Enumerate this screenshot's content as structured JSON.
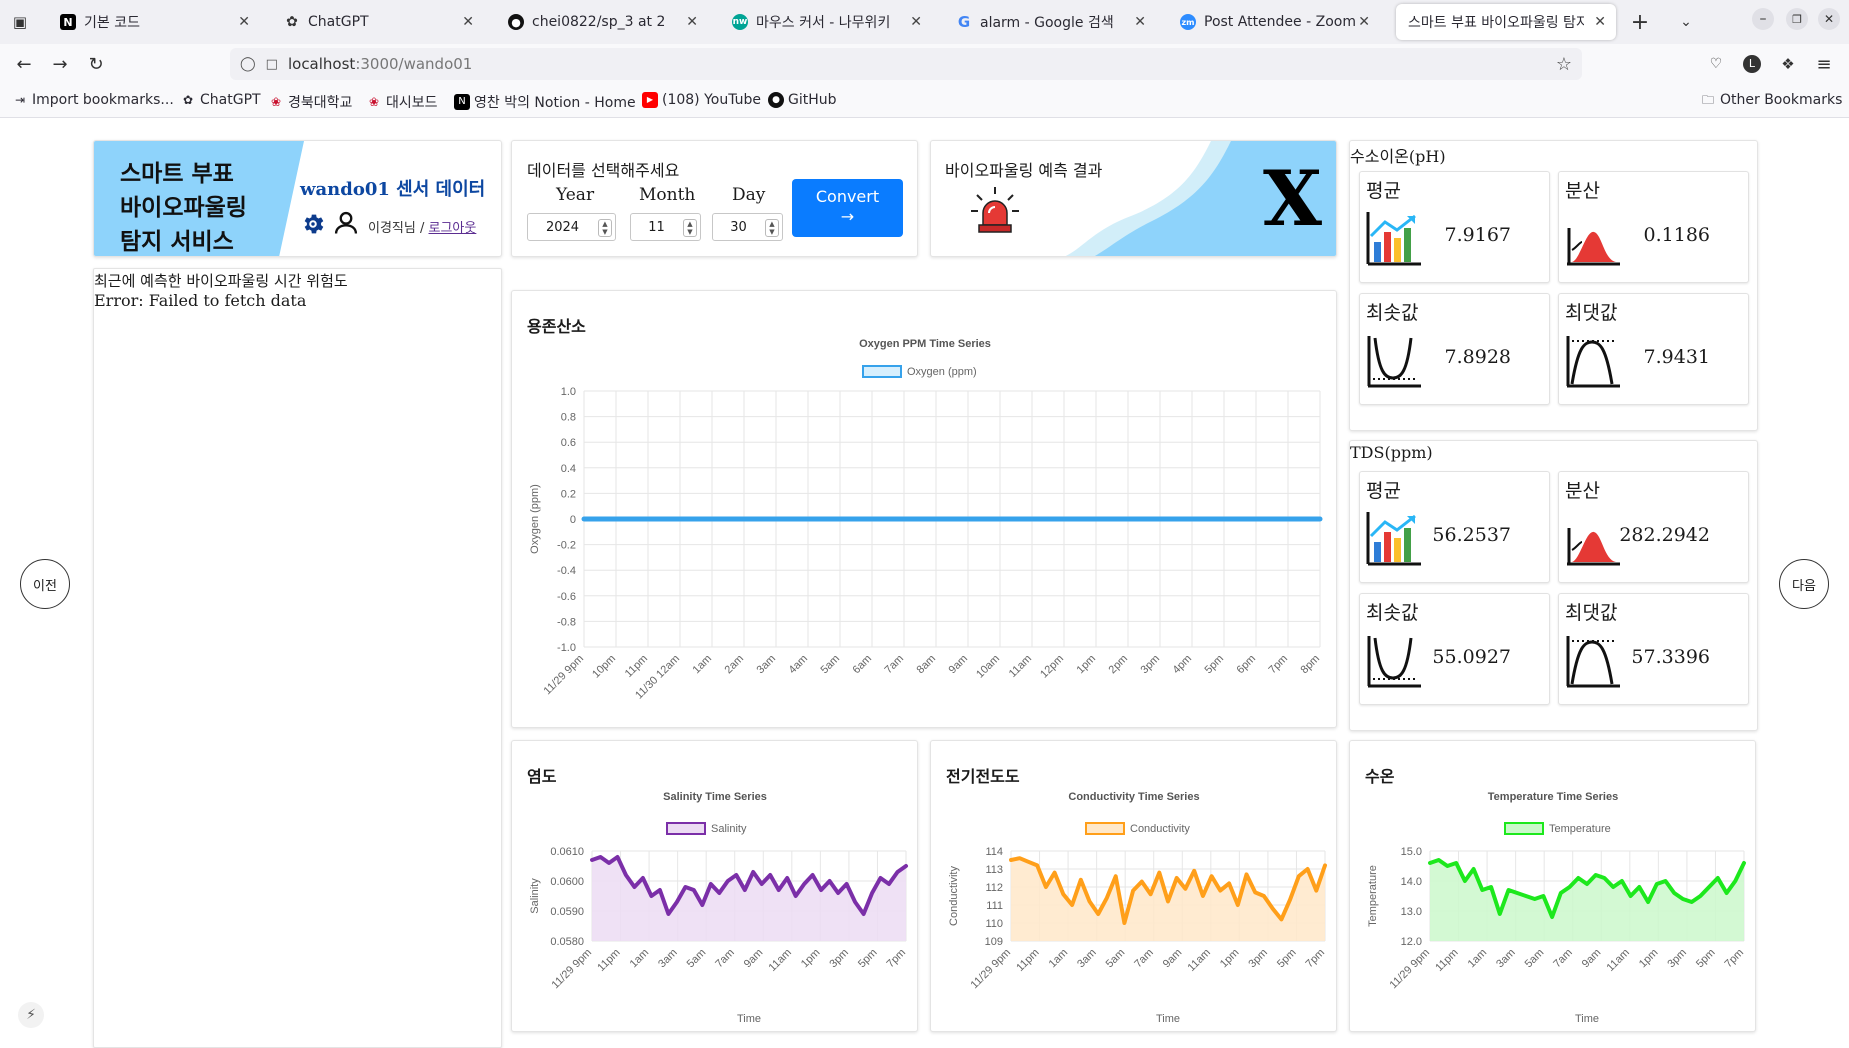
{
  "tabs": [
    {
      "label": "기본 코드",
      "icon": "notion-icon"
    },
    {
      "label": "ChatGPT",
      "icon": "chatgpt-icon"
    },
    {
      "label": "chei0822/sp_3 at 2",
      "icon": "github-icon"
    },
    {
      "label": "마우스 커서 - 나무위키",
      "icon": "namuwiki-icon"
    },
    {
      "label": "alarm - Google 검색",
      "icon": "google-icon"
    },
    {
      "label": "Post Attendee - Zoom",
      "icon": "zoom-icon"
    },
    {
      "label": "스마트 부표 바이오파울링 탐지",
      "icon": ""
    }
  ],
  "url": {
    "host": "localhost",
    "path": ":3000/wando01"
  },
  "bookmarks": [
    {
      "label": "Import bookmarks...",
      "icon": "import-icon"
    },
    {
      "label": "ChatGPT",
      "icon": "chatgpt-icon"
    },
    {
      "label": "경북대학교",
      "icon": "knu-icon"
    },
    {
      "label": "대시보드",
      "icon": "knu-icon"
    },
    {
      "label": "영찬 박의 Notion - Home",
      "icon": "notion-icon"
    },
    {
      "label": "(108) YouTube",
      "icon": "youtube-icon"
    },
    {
      "label": "GitHub",
      "icon": "github-icon"
    }
  ],
  "other_bookmarks": "Other Bookmarks",
  "header": {
    "service_line1": "스마트 부표",
    "service_line2": "바이오파울링",
    "service_line3": "탐지 서비스",
    "sensor_title": "wando01 센서 데이터",
    "user_name": "이경직님",
    "separator": " / ",
    "logout": "로그아웃"
  },
  "select": {
    "title": "데이터를 선택해주세요",
    "year_label": "Year",
    "year": "2024",
    "month_label": "Month",
    "month": "11",
    "day_label": "Day",
    "day": "30",
    "convert_label": "Convert",
    "convert_arrow": "→"
  },
  "prediction": {
    "title": "바이오파울링 예측 결과",
    "result": "X"
  },
  "recent": {
    "title": "최근에 예측한 바이오파울링 시간 위험도",
    "error": "Error: Failed to fetch data"
  },
  "nav": {
    "prev": "이전",
    "next": "다음"
  },
  "ph": {
    "title": "수소이온(pH)",
    "mean_label": "평균",
    "mean": "7.9167",
    "var_label": "분산",
    "var": "0.1186",
    "min_label": "최솟값",
    "min": "7.8928",
    "max_label": "최댓값",
    "max": "7.9431"
  },
  "tds": {
    "title": "TDS(ppm)",
    "mean_label": "평균",
    "mean": "56.2537",
    "var_label": "분산",
    "var": "282.2942",
    "min_label": "최솟값",
    "min": "55.0927",
    "max_label": "최댓값",
    "max": "57.3396"
  },
  "cards": {
    "oxygen": "용존산소",
    "salinity": "염도",
    "conductivity": "전기전도도",
    "temperature": "수온"
  },
  "chart_data": [
    {
      "type": "line",
      "title": "Oxygen PPM Time Series",
      "series_name": "Oxygen (ppm)",
      "ylabel": "Oxygen (ppm)",
      "xlabel": "",
      "color": "#36a2eb",
      "ylim": [
        -1.0,
        1.0
      ],
      "yticks": [
        "1.0",
        "0.8",
        "0.6",
        "0.4",
        "0.2",
        "0",
        "-0.2",
        "-0.4",
        "-0.6",
        "-0.8",
        "-1.0"
      ],
      "xticks": [
        "11/29 9pm",
        "10pm",
        "11pm",
        "11/30 12am",
        "1am",
        "2am",
        "3am",
        "4am",
        "5am",
        "6am",
        "7am",
        "8am",
        "9am",
        "10am",
        "11am",
        "12pm",
        "1pm",
        "2pm",
        "3pm",
        "4pm",
        "5pm",
        "6pm",
        "7pm",
        "8pm"
      ],
      "x": [
        "11/29 9pm",
        "8pm"
      ],
      "values": [
        0,
        0
      ]
    },
    {
      "type": "area",
      "title": "Salinity Time Series",
      "series_name": "Salinity",
      "ylabel": "Salinity",
      "xlabel": "Time",
      "color": "#7b2fa8",
      "fill": "#ecdcf3",
      "ylim": [
        0.058,
        0.061
      ],
      "yticks": [
        "0.0610",
        "0.0600",
        "0.0590",
        "0.0580"
      ],
      "xticks": [
        "11/29 9pm",
        "11pm",
        "1am",
        "3am",
        "5am",
        "7am",
        "9am",
        "11am",
        "1pm",
        "3pm",
        "5pm",
        "7pm"
      ],
      "values": [
        0.0607,
        0.0608,
        0.0606,
        0.0608,
        0.0602,
        0.0598,
        0.0601,
        0.0595,
        0.0597,
        0.0589,
        0.0593,
        0.0598,
        0.0597,
        0.0592,
        0.0599,
        0.0596,
        0.06,
        0.0602,
        0.0597,
        0.0603,
        0.0599,
        0.0602,
        0.0597,
        0.0601,
        0.0595,
        0.0599,
        0.0602,
        0.0597,
        0.06,
        0.0596,
        0.0599,
        0.0593,
        0.0589,
        0.0596,
        0.0601,
        0.0599,
        0.0603,
        0.0605
      ]
    },
    {
      "type": "area",
      "title": "Conductivity Time Series",
      "series_name": "Conductivity",
      "ylabel": "Conductivity",
      "xlabel": "Time",
      "color": "#ff9f1a",
      "fill": "#ffe8c9",
      "ylim": [
        109,
        114
      ],
      "yticks": [
        "114",
        "113",
        "112",
        "111",
        "110",
        "109"
      ],
      "xticks": [
        "11/29 9pm",
        "11pm",
        "1am",
        "3am",
        "5am",
        "7am",
        "9am",
        "11am",
        "1pm",
        "3pm",
        "5pm",
        "7pm"
      ],
      "values": [
        113.5,
        113.6,
        113.4,
        113.2,
        112.0,
        112.8,
        111.6,
        111.0,
        112.4,
        111.2,
        110.5,
        111.4,
        112.6,
        110.0,
        111.8,
        112.3,
        111.6,
        112.8,
        111.2,
        112.5,
        111.9,
        112.9,
        111.5,
        112.6,
        111.8,
        112.2,
        111.0,
        112.7,
        111.7,
        111.5,
        110.8,
        110.2,
        111.3,
        112.6,
        113.0,
        111.8,
        113.2
      ]
    },
    {
      "type": "area",
      "title": "Temperature Time Series",
      "series_name": "Temperature",
      "ylabel": "Temperature",
      "xlabel": "Time",
      "color": "#1de81d",
      "fill": "#cbf8cb",
      "ylim": [
        12.0,
        15.0
      ],
      "yticks": [
        "15.0",
        "14.0",
        "13.0",
        "12.0"
      ],
      "xticks": [
        "11/29 9pm",
        "11pm",
        "1am",
        "3am",
        "5am",
        "7am",
        "9am",
        "11am",
        "1pm",
        "3pm",
        "5pm",
        "7pm"
      ],
      "values": [
        14.6,
        14.7,
        14.5,
        14.6,
        14.0,
        14.4,
        13.7,
        13.8,
        12.9,
        13.7,
        13.6,
        13.5,
        13.4,
        13.5,
        12.8,
        13.6,
        13.8,
        14.1,
        13.9,
        14.2,
        14.1,
        13.8,
        14.0,
        13.5,
        13.8,
        13.3,
        13.9,
        14.0,
        13.6,
        13.4,
        13.3,
        13.5,
        13.8,
        14.1,
        13.6,
        14.0,
        14.6
      ]
    }
  ]
}
